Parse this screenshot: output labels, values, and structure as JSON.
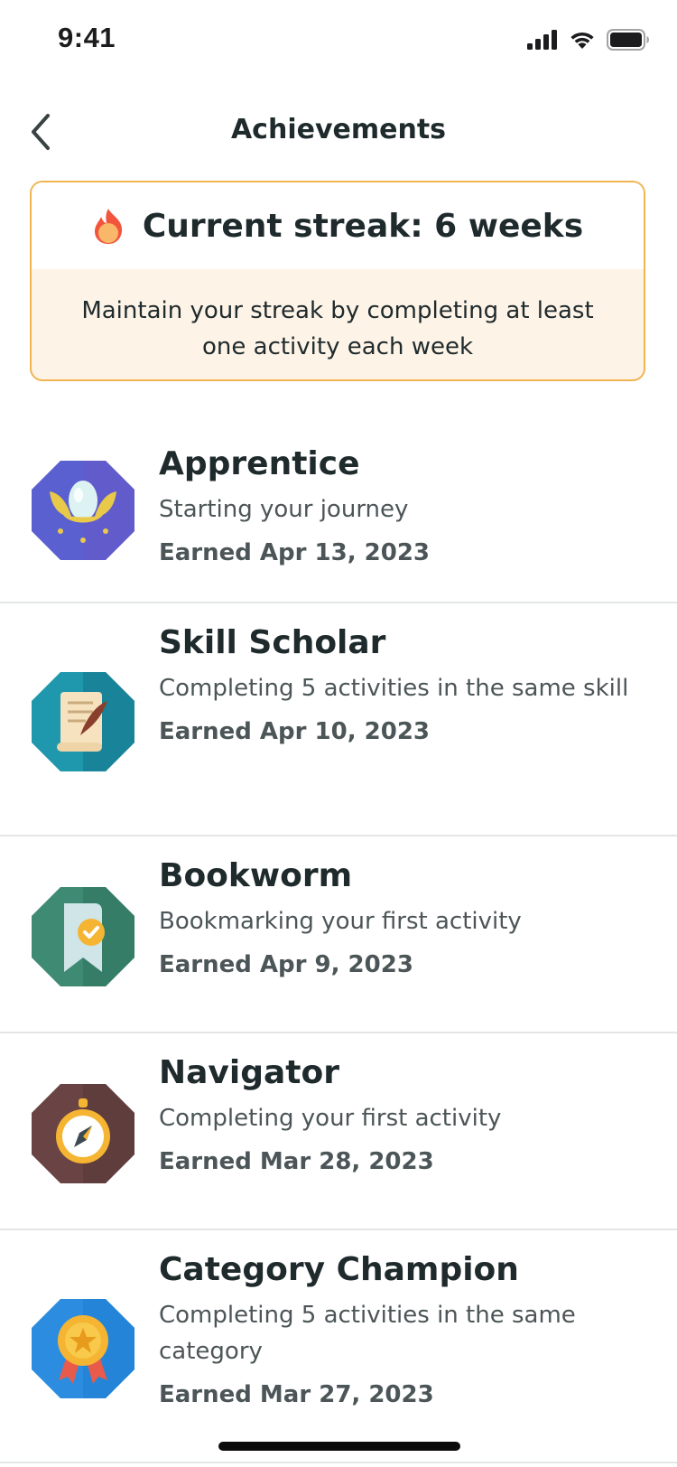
{
  "status_bar": {
    "time": "9:41",
    "signal_icon": "cellular-signal-icon",
    "wifi_icon": "wifi-icon",
    "battery_icon": "battery-icon"
  },
  "header": {
    "back_icon": "chevron-left-icon",
    "title": "Achievements"
  },
  "streak": {
    "icon": "flame-icon",
    "title": "Current streak: 6 weeks",
    "description": "Maintain your streak by completing at least one activity each week",
    "border_color": "#f0b552",
    "background_color": "#fdf3e7"
  },
  "achievements": [
    {
      "title": "Apprentice",
      "description": "Starting your journey",
      "earned": "Earned Apr 13, 2023",
      "icon": "lotus-egg-badge-icon",
      "color": "#5a60cf"
    },
    {
      "title": "Skill Scholar",
      "description": "Completing 5 activities in the same skill",
      "earned": "Earned Apr 10, 2023",
      "icon": "scroll-quill-badge-icon",
      "color": "#1f97ad"
    },
    {
      "title": "Bookworm",
      "description": "Bookmarking your first activity",
      "earned": "Earned Apr 9, 2023",
      "icon": "bookmark-check-badge-icon",
      "color": "#3f8a72"
    },
    {
      "title": "Navigator",
      "description": "Completing your first activity",
      "earned": "Earned Mar 28, 2023",
      "icon": "compass-badge-icon",
      "color": "#6a4444"
    },
    {
      "title": "Category Champion",
      "description": "Completing 5 activities in the same category",
      "earned": "Earned Mar 27, 2023",
      "icon": "medal-badge-icon",
      "color": "#2c8de0"
    }
  ]
}
